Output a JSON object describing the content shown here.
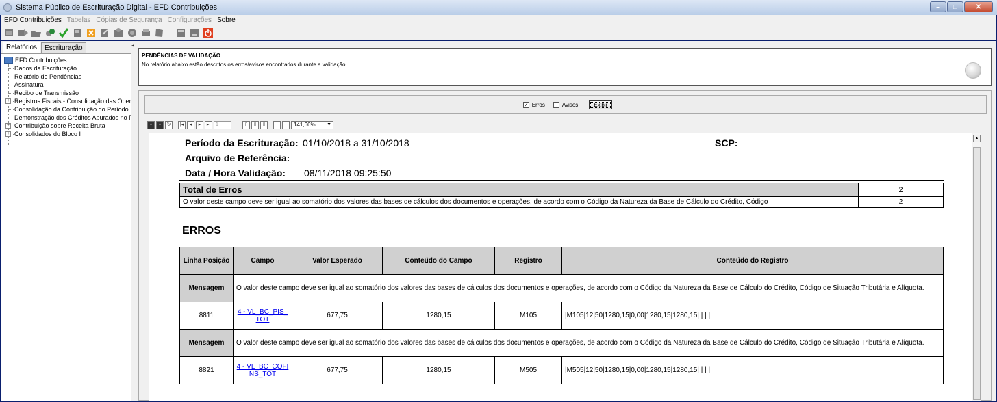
{
  "window": {
    "title": "Sistema Público de Escrituração Digital - EFD Contribuições"
  },
  "menu": {
    "items": [
      {
        "label": "EFD Contribuições",
        "enabled": true
      },
      {
        "label": "Tabelas",
        "enabled": false
      },
      {
        "label": "Cópias de Segurança",
        "enabled": false
      },
      {
        "label": "Configurações",
        "enabled": false
      },
      {
        "label": "Sobre",
        "enabled": true
      }
    ]
  },
  "toolbar": {
    "icons": [
      "new-icon",
      "import-icon",
      "open-icon",
      "certificate-icon",
      "validate-icon",
      "save-icon",
      "delete-icon",
      "sign-icon",
      "transmit-icon",
      "receipt-icon",
      "printer-icon",
      "binder-icon",
      "close-file-icon",
      "backup-icon",
      "exit-icon"
    ]
  },
  "sidebar": {
    "tabs": [
      "Relatórios",
      "Escrituração"
    ],
    "root": "EFD Contribuições",
    "items": [
      {
        "label": "Dados da Escrituração",
        "expandable": false
      },
      {
        "label": "Relatório de Pendências",
        "expandable": false
      },
      {
        "label": "Assinatura",
        "expandable": false
      },
      {
        "label": "Recibo de Transmissão",
        "expandable": false
      },
      {
        "label": "Registros Fiscais - Consolidação das Operaçõ",
        "expandable": true
      },
      {
        "label": "Consolidação da Contribuição do Período",
        "expandable": false
      },
      {
        "label": "Demonstração dos Créditos Apurados no Perío",
        "expandable": false
      },
      {
        "label": "Contribuição sobre Receita Bruta",
        "expandable": true
      },
      {
        "label": "Consolidados do Bloco I",
        "expandable": true
      }
    ]
  },
  "pendencias": {
    "title": "PENDÊNCIAS DE VALIDAÇÃO",
    "description": "No relatório abaixo estão descritos os erros/avisos encontrados durante a validação."
  },
  "filter": {
    "erros_label": "Erros",
    "erros_checked": true,
    "avisos_label": "Avisos",
    "avisos_checked": false,
    "exibir_label": "Exibir"
  },
  "viewer": {
    "page": "1",
    "zoom": "141,66%"
  },
  "report": {
    "periodo_label": "Período da Escrituração:",
    "periodo_value": "01/10/2018 a 31/10/2018",
    "scp_label": "SCP:",
    "arquivo_label": "Arquivo de Referência:",
    "data_label": "Data / Hora Validação:",
    "data_value": "08/11/2018 09:25:50",
    "total_label": "Total de Erros",
    "total_value": "2",
    "summary_text": "O valor deste campo deve ser igual ao somatório dos valores das bases de cálculos dos documentos e operações, de acordo com o Código da Natureza da Base de Cálculo do Crédito, Código",
    "summary_count": "2",
    "erros_title": "ERROS",
    "columns": [
      "Linha Posição",
      "Campo",
      "Valor Esperado",
      "Conteúdo do Campo",
      "Registro",
      "Conteúdo do Registro"
    ],
    "mensagem_label": "Mensagem",
    "errors": [
      {
        "message": "O valor deste campo deve ser igual ao somatório dos valores das bases de cálculos dos documentos e operações, de acordo com o Código da Natureza da Base de Cálculo do Crédito, Código de Situação Tributária e Alíquota.",
        "linha": "8811",
        "campo": "4 - VL_BC_PIS_TOT",
        "valor_esperado": "677,75",
        "conteudo_campo": "1280,15",
        "registro": "M105",
        "conteudo_registro": "|M105|12|50|1280,15|0,00|1280,15|1280,15| | | |"
      },
      {
        "message": "O valor deste campo deve ser igual ao somatório dos valores das bases de cálculos dos documentos e operações, de acordo com o Código da Natureza da Base de Cálculo do Crédito, Código de Situação Tributária e Alíquota.",
        "linha": "8821",
        "campo": "4 - VL_BC_COFINS_TOT",
        "valor_esperado": "677,75",
        "conteudo_campo": "1280,15",
        "registro": "M505",
        "conteudo_registro": "|M505|12|50|1280,15|0,00|1280,15|1280,15| | | |"
      }
    ]
  }
}
